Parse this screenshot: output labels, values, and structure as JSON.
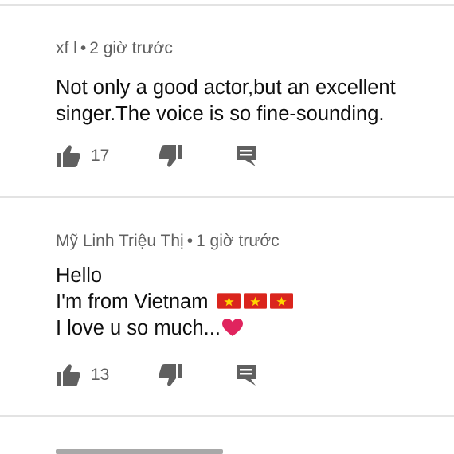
{
  "comments": [
    {
      "author": "xf l",
      "separator": "•",
      "time": "2 giờ trước",
      "lines": [
        "Not only a good actor,but an excellent",
        "singer.The voice is so fine-sounding."
      ],
      "like_count": "17",
      "icons": {
        "like": "thumbs-up-icon",
        "dislike": "thumbs-down-icon",
        "reply": "reply-comment-icon"
      }
    },
    {
      "author": "Mỹ Linh Triệu Thị",
      "separator": "•",
      "time": "1 giờ trước",
      "lines": [
        "Hello",
        "I'm from Vietnam",
        "I love u so much..."
      ],
      "emoji": {
        "flags": "vietnam-flag-icon",
        "flag_count": 3,
        "heart": "red-heart-icon"
      },
      "like_count": "13",
      "icons": {
        "like": "thumbs-up-icon",
        "dislike": "thumbs-down-icon",
        "reply": "reply-comment-icon"
      }
    }
  ],
  "colors": {
    "text_primary": "#0f0f0f",
    "text_secondary": "#606060",
    "icon": "#606060",
    "divider": "#e3e3e3",
    "flag_red": "#da251d",
    "flag_star": "#ffd700",
    "heart": "#e0245e"
  }
}
